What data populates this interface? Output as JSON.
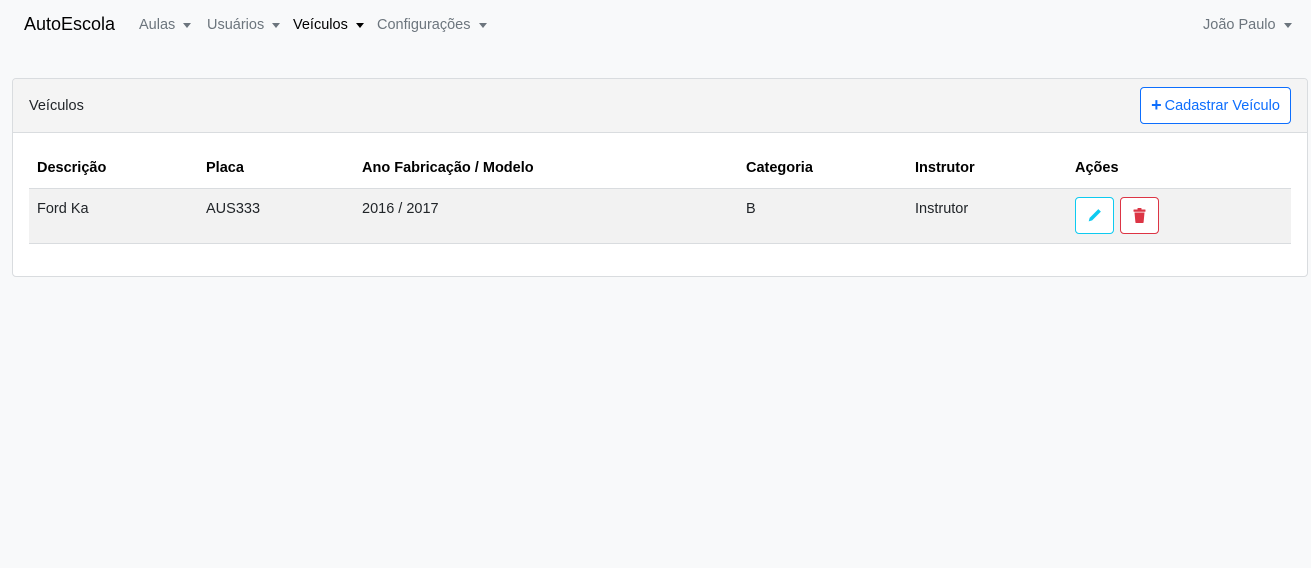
{
  "navbar": {
    "brand": "AutoEscola",
    "items": [
      {
        "label": "Aulas"
      },
      {
        "label": "Usuários"
      },
      {
        "label": "Veículos"
      },
      {
        "label": "Configurações"
      }
    ],
    "user": "João Paulo"
  },
  "card": {
    "title": "Veículos",
    "add_button": "Cadastrar Veículo"
  },
  "table": {
    "headers": [
      "Descrição",
      "Placa",
      "Ano Fabricação / Modelo",
      "Categoria",
      "Instrutor",
      "Ações"
    ],
    "rows": [
      {
        "descricao": "Ford Ka",
        "placa": "AUS333",
        "ano": "2016 / 2017",
        "categoria": "B",
        "instrutor": "Instrutor"
      }
    ]
  },
  "colors": {
    "primary": "#0d6efd",
    "info": "#0dcaf0",
    "danger": "#dc3545"
  },
  "icons": {
    "edit": "pencil-icon",
    "delete": "trash-icon",
    "add": "plus-icon"
  }
}
